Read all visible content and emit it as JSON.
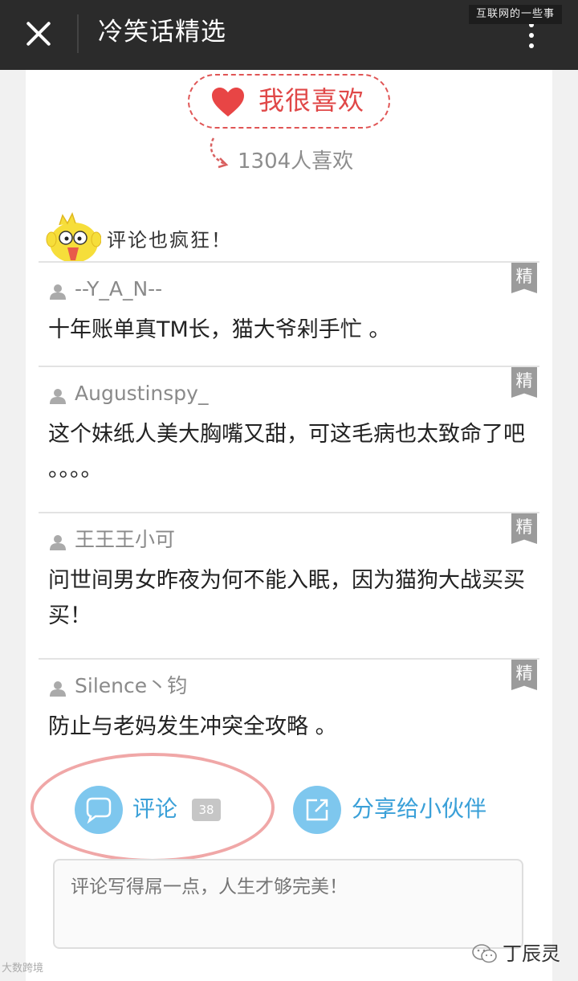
{
  "header": {
    "title": "冷笑话精选",
    "watermark": "互联网的一些事"
  },
  "like": {
    "label": "我很喜欢",
    "count_text": "1304人喜欢"
  },
  "comments_section": {
    "heading": "评论也疯狂！",
    "featured_label": "精",
    "items": [
      {
        "user": "--Y_A_N--",
        "text": "十年账单真TM长，猫大爷剁手忙 。"
      },
      {
        "user": "Augustinspy_",
        "text": "这个妹纸人美大胸嘴又甜，可这毛病也太致命了吧 。。。。"
      },
      {
        "user": "王王王小可",
        "text": "问世间男女昨夜为何不能入眠，因为猫狗大战买买买！"
      },
      {
        "user": "Silence丶钧",
        "text": "防止与老妈发生冲突全攻略 。"
      }
    ]
  },
  "actions": {
    "comment_label": "评论",
    "comment_count": "38",
    "share_label": "分享给小伙伴"
  },
  "input": {
    "placeholder": "评论写得屌一点，人生才够完美！"
  },
  "footer": {
    "watermark_left": "大数跨境",
    "watermark_right": "丁辰灵"
  },
  "colors": {
    "topbar": "#2b2b2b",
    "like_red": "#e04848",
    "link_blue": "#3aa0d8",
    "icon_blue": "#7ec7ee",
    "highlight_pink": "#f0a7a7"
  }
}
